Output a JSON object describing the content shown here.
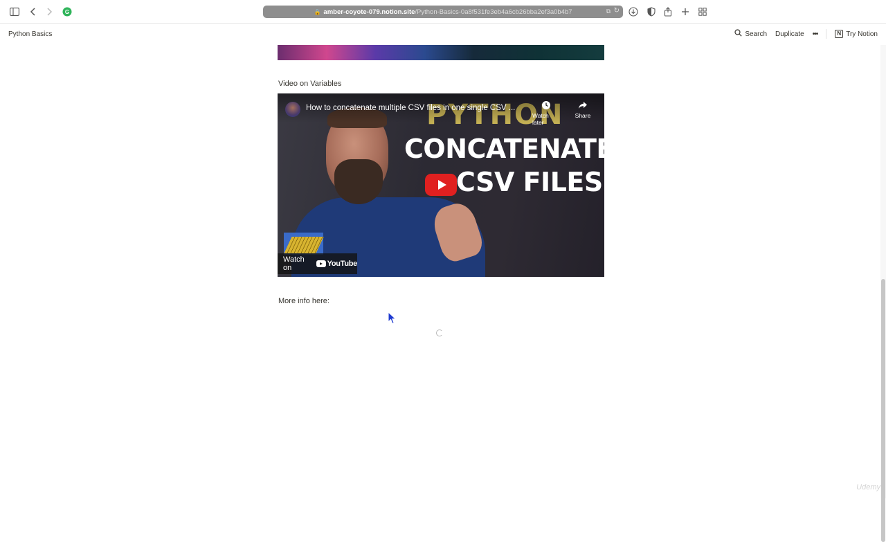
{
  "browser": {
    "url_host": "amber-coyote-079.notion.site",
    "url_path": "/Python-Basics-0a8f531fe3eb4a6cb26bba2ef3a0b4b7",
    "icons": [
      "sidebar-icon",
      "back-icon",
      "forward-icon",
      "extension-icon",
      "lock-icon",
      "translate-icon",
      "reload-icon",
      "download-icon",
      "privacy-icon",
      "share-icon",
      "new-tab-icon",
      "tab-overview-icon"
    ]
  },
  "notion": {
    "page_title": "Python Basics",
    "search_label": "Search",
    "duplicate_label": "Duplicate",
    "more_label": "•••",
    "try_label": "Try Notion",
    "logo_letter": "N"
  },
  "content": {
    "video_heading": "Video on Variables",
    "more_info": "More info here:"
  },
  "video": {
    "title": "How to concatenate multiple CSV files in one single CSV ...",
    "thumb_line1": "PYTHON",
    "thumb_line2": "CONCATENATE",
    "thumb_line3": "CSV FILES",
    "watch_later": "Watch later",
    "share": "Share",
    "watch_on": "Watch on",
    "youtube": "YouTube"
  },
  "watermark": "Udemy",
  "colors": {
    "accent_play": "#e02020",
    "url_bar": "#8e8e8e",
    "text": "#37352f"
  }
}
